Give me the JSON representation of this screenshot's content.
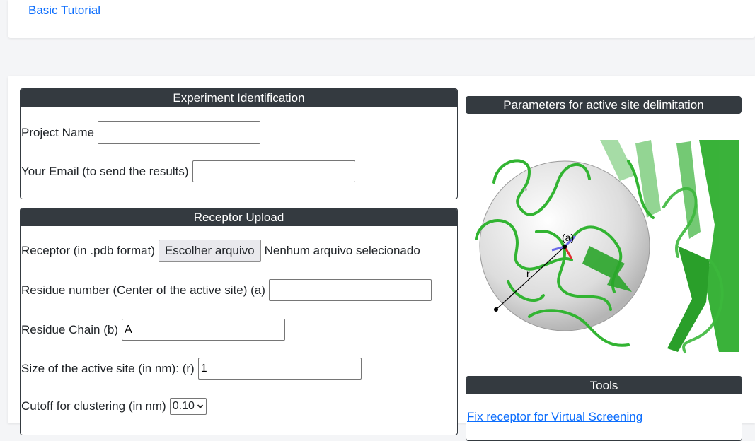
{
  "top": {
    "tutorial_link": "Basic Tutorial"
  },
  "experiment": {
    "title": "Experiment Identification",
    "project_label": "Project Name",
    "project_value": "",
    "email_label": "Your Email (to send the results)",
    "email_value": ""
  },
  "receptor": {
    "title": "Receptor Upload",
    "file_label": "Receptor (in .pdb format)",
    "file_button": "Escolher arquivo",
    "file_status": "Nenhum arquivo selecionado",
    "residue_label": "Residue number (Center of the active site) (a)",
    "residue_value": "",
    "chain_label": "Residue Chain (b)",
    "chain_value": "A",
    "size_label": "Size of the active site (in nm): (r)",
    "size_value": "1",
    "cutoff_label": "Cutoff for clustering (in nm)",
    "cutoff_selected": "0.10"
  },
  "parameters": {
    "title": "Parameters for active site delimitation",
    "figure_center_label": "(a)",
    "figure_radius_label": "r"
  },
  "tools": {
    "title": "Tools",
    "fix_link": "Fix receptor for Virtual Screening"
  },
  "colors": {
    "header_bg": "#343a40",
    "link": "#0d6efd",
    "protein_green": "#3cb83c"
  }
}
